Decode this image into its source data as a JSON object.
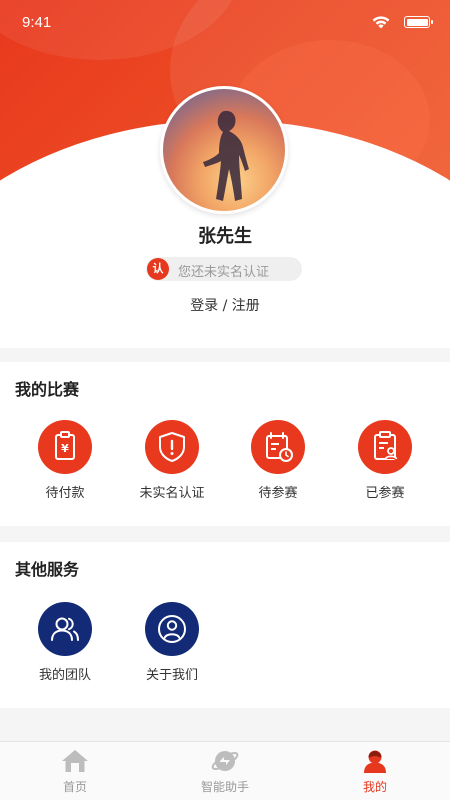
{
  "status_bar": {
    "time": "9:41"
  },
  "profile": {
    "name": "张先生",
    "verify_badge": "认",
    "verify_text": "您还未实名认证",
    "login_text": "登录 / 注册"
  },
  "my_matches": {
    "title": "我的比赛",
    "items": [
      {
        "label": "待付款",
        "icon": "payment-tag-icon"
      },
      {
        "label": "未实名认证",
        "icon": "shield-alert-icon"
      },
      {
        "label": "待参赛",
        "icon": "calendar-clock-icon"
      },
      {
        "label": "已参赛",
        "icon": "clipboard-person-icon"
      }
    ]
  },
  "other_services": {
    "title": "其他服务",
    "items": [
      {
        "label": "我的团队",
        "icon": "team-icon"
      },
      {
        "label": "关于我们",
        "icon": "about-us-icon"
      }
    ]
  },
  "tabbar": {
    "items": [
      {
        "label": "首页",
        "icon": "home-icon",
        "active": false
      },
      {
        "label": "智能助手",
        "icon": "assistant-icon",
        "active": false
      },
      {
        "label": "我的",
        "icon": "profile-icon",
        "active": true
      }
    ]
  },
  "colors": {
    "brand_red": "#e8381e",
    "navy": "#132b76"
  }
}
